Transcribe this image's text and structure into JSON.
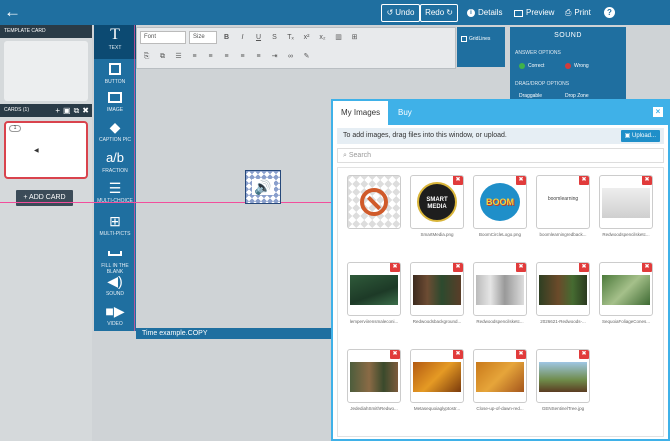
{
  "topbar": {
    "back_icon": "arrow-left-icon",
    "undo_label": "Undo",
    "redo_label": "Redo",
    "details_label": "Details",
    "preview_label": "Preview",
    "print_label": "Print",
    "help_label": "?"
  },
  "left_panel": {
    "template_header": "TEMPLATE CARD",
    "cards_header": "CARDS (1)",
    "card_number": "1",
    "add_card_label": "+ ADD CARD"
  },
  "tools": [
    {
      "label": "TEXT",
      "icon": "text-icon"
    },
    {
      "label": "BUTTON",
      "icon": "button-icon"
    },
    {
      "label": "IMAGE",
      "icon": "image-icon"
    },
    {
      "label": "CAPTION PIC",
      "icon": "tag-icon"
    },
    {
      "label": "FRACTION",
      "icon": "fraction-icon"
    },
    {
      "label": "MULTI-CHOICE",
      "icon": "list-icon"
    },
    {
      "label": "MULTI-PICTS",
      "icon": "grid-icon"
    },
    {
      "label": "FILL IN THE BLANK",
      "icon": "blank-icon"
    },
    {
      "label": "SOUND",
      "icon": "speaker-icon"
    },
    {
      "label": "VIDEO",
      "icon": "video-icon"
    }
  ],
  "fraction_glyph": "a/b",
  "toolbar": {
    "font_label": "Font",
    "size_label": "Size"
  },
  "gridlines_label": "GridLines",
  "sound_panel": {
    "title": "SOUND",
    "answer_options": "ANSWER OPTIONS",
    "correct": "Correct",
    "wrong": "Wrong",
    "dragdrop": "DRAG/DROP OPTIONS",
    "draggable": "Draggable",
    "dropzone": "Drop Zone"
  },
  "canvas_caption": "Time example.COPY",
  "dialog": {
    "tab_my_images": "My Images",
    "tab_buy": "Buy",
    "info_text": "To add images, drag files into this window, or upload.",
    "upload_label": "Upload...",
    "search_placeholder": "Search",
    "images": [
      {
        "name": "",
        "deletable": false
      },
      {
        "name": "SmartMedia.png",
        "deletable": true
      },
      {
        "name": "BoomCircleLogo.png",
        "deletable": true
      },
      {
        "name": "boomlearningredback...",
        "deletable": true
      },
      {
        "name": "Redwoodspencilsketc...",
        "deletable": true
      },
      {
        "name": "lemperviirensmaleconi...",
        "deletable": true
      },
      {
        "name": "Redwoodsbackground...",
        "deletable": true
      },
      {
        "name": "Redwoodspencilsketc...",
        "deletable": true
      },
      {
        "name": "2026621-Redwoods-...",
        "deletable": true
      },
      {
        "name": "SequoiaFoliageCones...",
        "deletable": true
      },
      {
        "name": "JedediahSmithRedwo...",
        "deletable": true
      },
      {
        "name": "Metasequoiaglyptostr...",
        "deletable": true
      },
      {
        "name": "Close-up-of-dawn-red...",
        "deletable": true
      },
      {
        "name": "GENSentinelTree.jpg",
        "deletable": true
      }
    ],
    "smart_media_text": "SMART MEDIA",
    "boom_text": "BOOM",
    "boomlearning_text": "boomlearning"
  }
}
